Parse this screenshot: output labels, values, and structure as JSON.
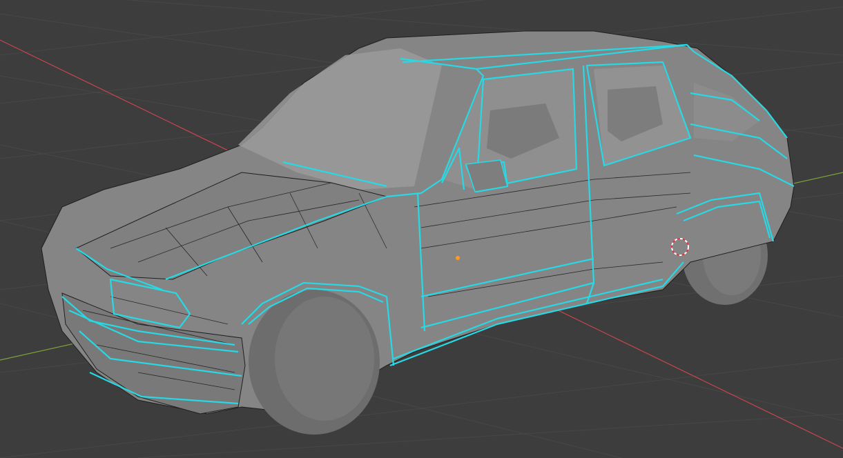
{
  "viewport": {
    "background": "#3d3d3d",
    "grid_color": "#474747",
    "axis_x_color": "#c94550",
    "axis_y_color": "#7ea33a"
  },
  "model": {
    "body_color": "#8a8a8a",
    "body_dark": "#6a6a6a",
    "glass_color": "#9c9c9c",
    "interior_color": "#828282",
    "tire_color": "#6f6f6f",
    "wire_color": "#1a1a1a",
    "seam_color": "#27d9e4"
  },
  "origin": {
    "color": "#ff9a1f"
  },
  "cursor_3d": {
    "colors": [
      "#ffffff",
      "#e5354a"
    ]
  },
  "icons": {
    "origin": "object-origin-icon",
    "cursor": "3d-cursor-icon"
  }
}
